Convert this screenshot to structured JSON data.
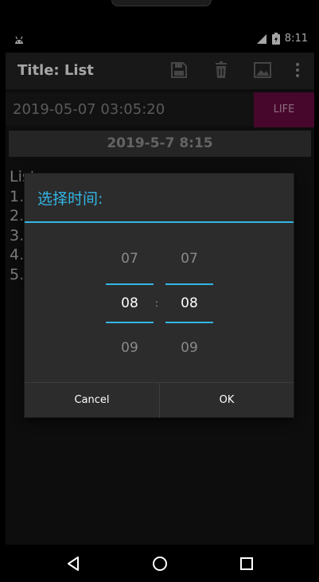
{
  "statusbar": {
    "time": "8:11"
  },
  "actionbar": {
    "title": "Title: List",
    "icons": [
      "save-icon",
      "delete-icon",
      "image-icon",
      "overflow-menu-icon"
    ]
  },
  "main": {
    "datetime": "2019-05-07 03:05:20",
    "life_label": "LIFE",
    "date_bar": "2019-5-7 8:15",
    "list_text": "List\n1.\n2.\n3.\n4.\n5."
  },
  "dialog": {
    "title": "选择时间:",
    "hour": {
      "prev": "07",
      "current": "08",
      "next": "09"
    },
    "minute": {
      "prev": "07",
      "current": "08",
      "next": "09"
    },
    "separator": ":",
    "cancel_label": "Cancel",
    "ok_label": "OK"
  },
  "colors": {
    "accent": "#33b5e5",
    "life_button": "#6e0b44"
  }
}
